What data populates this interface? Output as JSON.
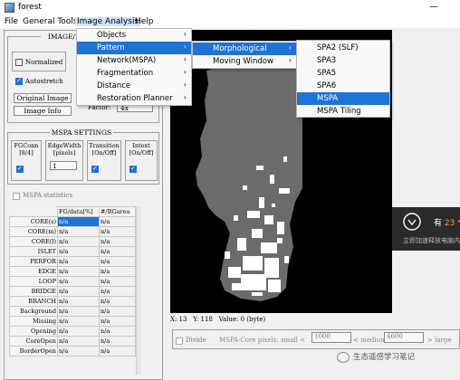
{
  "window": {
    "title": "forest",
    "minimize_glyph": "—"
  },
  "menubar": {
    "file": "File",
    "general_tools": "General Tools",
    "image_analysis": "Image Analysis",
    "help": "Help"
  },
  "image_analysis_menu": [
    "Objects",
    "Pattern",
    "Network(MSPA)",
    "Fragmentation",
    "Distance",
    "Restoration Planner"
  ],
  "pattern_menu": [
    "Morphological",
    "Moving Window"
  ],
  "morphological_menu": [
    "SPA2 (SLF)",
    "SPA3",
    "SPA5",
    "SPA6",
    "MSPA",
    "MSPA Tiling"
  ],
  "left": {
    "image_group_label": "IMAGE/DIS",
    "normalized": "Normalized",
    "autostretch": "Autostretch",
    "original_image": "Original Image",
    "image_info": "Image Info",
    "factor_label": "Factor:",
    "factor_value": "4x",
    "mspa_settings": "MSPA SETTINGS",
    "fgconn_label": "FGConn\n[8/4]",
    "edgewidth_label": "EdgeWidth\n[pixels]",
    "edgewidth_value": "1",
    "transition_label": "Transition\n[On/Off]",
    "intext_label": "Intext\n[On/Off]",
    "mspa_statistics": "MSPA statistics"
  },
  "stats_table": {
    "headers": [
      "FG/data[%]",
      "#/BGarea"
    ],
    "rows": [
      {
        "label": "CORE(s)",
        "fg": "n/a",
        "bg": "n/a"
      },
      {
        "label": "CORE(m)",
        "fg": "n/a",
        "bg": "n/a"
      },
      {
        "label": "CORE(l)",
        "fg": "n/a",
        "bg": "n/a"
      },
      {
        "label": "ISLET",
        "fg": "n/a",
        "bg": "n/a"
      },
      {
        "label": "PERFOR",
        "fg": "n/a",
        "bg": "n/a"
      },
      {
        "label": "EDGE",
        "fg": "n/a",
        "bg": "n/a"
      },
      {
        "label": "LOOP",
        "fg": "n/a",
        "bg": "n/a"
      },
      {
        "label": "BRIDGE",
        "fg": "n/a",
        "bg": "n/a"
      },
      {
        "label": "BRANCH",
        "fg": "n/a",
        "bg": "n/a"
      },
      {
        "label": "Background",
        "fg": "n/a",
        "bg": "n/a"
      },
      {
        "label": "Missing",
        "fg": "n/a",
        "bg": "n/a"
      },
      {
        "label": "Opening",
        "fg": "n/a",
        "bg": "n/a"
      },
      {
        "label": "CoreOpen",
        "fg": "n/a",
        "bg": "n/a"
      },
      {
        "label": "BorderOpen",
        "fg": "n/a",
        "bg": "n/a"
      }
    ]
  },
  "status": {
    "x": "X: 13",
    "y": "Y: 118",
    "value": "Value: 0 (byte)"
  },
  "bottom": {
    "divide": "Divide",
    "core_pixels": "MSPA-Core pixels: small <",
    "small_value": "1000",
    "medium": "< medium <",
    "medium_value": "4600",
    "large": "> large"
  },
  "notification": {
    "line1_prefix": "有",
    "line1_count": "23",
    "line1_suffix": "个",
    "line2": "立即加速释放电脑内"
  },
  "watermark": "生态遥感学习笔记"
}
